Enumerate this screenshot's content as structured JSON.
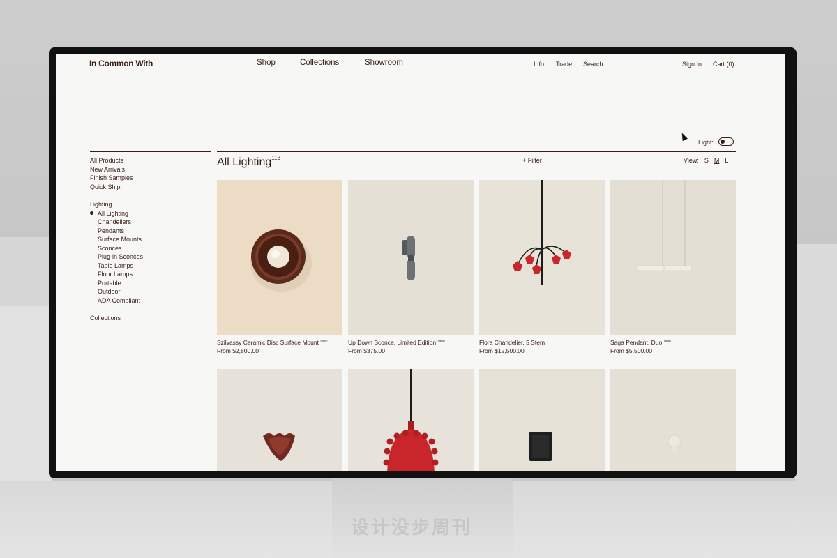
{
  "header": {
    "logo": "In Common With",
    "nav": [
      "Shop",
      "Collections",
      "Showroom"
    ],
    "utility": [
      "Info",
      "Trade",
      "Search"
    ],
    "account": [
      "Sign In",
      "Cart (0)"
    ]
  },
  "light_toggle": {
    "label": "Light:"
  },
  "sidebar": {
    "primary": [
      "All Products",
      "New Arrivals",
      "Finish Samples",
      "Quick Ship"
    ],
    "section_title": "Lighting",
    "sub_items": [
      "All Lighting",
      "Chandeliers",
      "Pendants",
      "Surface Mounts",
      "Sconces",
      "Plug-in Sconces",
      "Table Lamps",
      "Floor Lamps",
      "Portable",
      "Outdoor",
      "ADA Compliant"
    ],
    "active_item": "All Lighting",
    "footer_item": "Collections"
  },
  "main": {
    "title": "All Lighting",
    "count": "113",
    "filter_label": "+ Filter",
    "view_label": "View:",
    "view_options": [
      "S",
      "M",
      "L"
    ],
    "view_selected": "M"
  },
  "products": [
    {
      "name": "Szilvassy Ceramic Disc Surface Mount",
      "badge": "New!",
      "price": "From $2,800.00"
    },
    {
      "name": "Up Down Sconce, Limited Edition",
      "badge": "New!",
      "price": "From $375.00"
    },
    {
      "name": "Flora Chandelier, 5 Stem",
      "badge": "",
      "price": "From $12,500.00"
    },
    {
      "name": "Saga Pendant, Duo",
      "badge": "New!",
      "price": "From $5,500.00"
    }
  ],
  "watermark": "设计没步周刊",
  "colors": {
    "text": "#3a1d14",
    "page_bg": "#f7f7f6",
    "image_bg": "#e8e4db",
    "accent_red": "#c8262a"
  }
}
